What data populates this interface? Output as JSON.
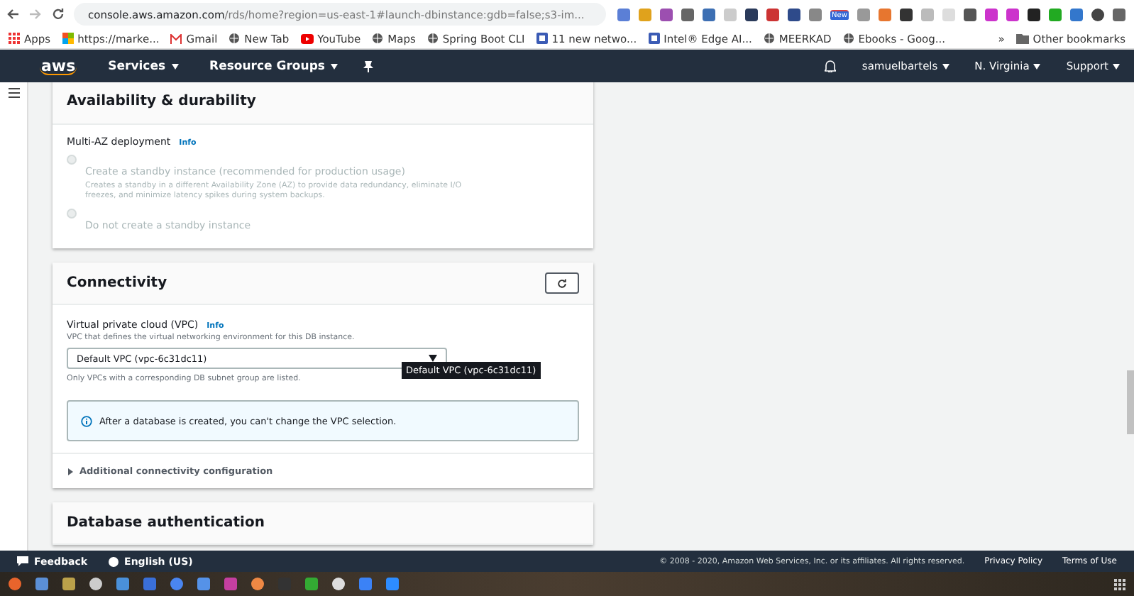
{
  "browser": {
    "url_host": "console.aws.amazon.com",
    "url_path": "/rds/home?region=us-east-1#launch-dbinstance:gdb=false;s3-im...",
    "extension_badge": "New",
    "bookmarks": [
      "Apps",
      "https://marke...",
      "Gmail",
      "New Tab",
      "YouTube",
      "Maps",
      "Spring Boot CLI",
      "11 new netwo...",
      "Intel® Edge AI...",
      "MEERKAD",
      "Ebooks - Goog..."
    ],
    "more": "»",
    "other_bookmarks": "Other bookmarks"
  },
  "nav": {
    "logo": "aws",
    "items": [
      "Services",
      "Resource Groups"
    ],
    "user": "samuelbartels",
    "region": "N. Virginia",
    "support": "Support"
  },
  "availability": {
    "title": "Availability & durability",
    "field_label": "Multi-AZ deployment",
    "info": "Info",
    "options": [
      {
        "label": "Create a standby instance (recommended for production usage)",
        "description": "Creates a standby in a different Availability Zone (AZ) to provide data redundancy, eliminate I/O freezes, and minimize latency spikes during system backups.",
        "selected": false,
        "disabled": true
      },
      {
        "label": "Do not create a standby instance",
        "selected": false,
        "disabled": true
      }
    ]
  },
  "connectivity": {
    "title": "Connectivity",
    "vpc_label": "Virtual private cloud (VPC)",
    "info": "Info",
    "vpc_description": "VPC that defines the virtual networking environment for this DB instance.",
    "vpc_value": "Default VPC (vpc-6c31dc11)",
    "tooltip": "Default VPC (vpc-6c31dc11)",
    "vpc_hint": "Only VPCs with a corresponding DB subnet group are listed.",
    "alert": "After a database is created, you can't change the VPC selection.",
    "additional": {
      "label": "Additional connectivity configuration",
      "expanded": false
    }
  },
  "authentication": {
    "title": "Database authentication"
  },
  "footer": {
    "feedback": "Feedback",
    "language": "English (US)",
    "copyright": "© 2008 - 2020, Amazon Web Services, Inc. or its affiliates. All rights reserved.",
    "privacy": "Privacy Policy",
    "terms": "Terms of Use"
  }
}
